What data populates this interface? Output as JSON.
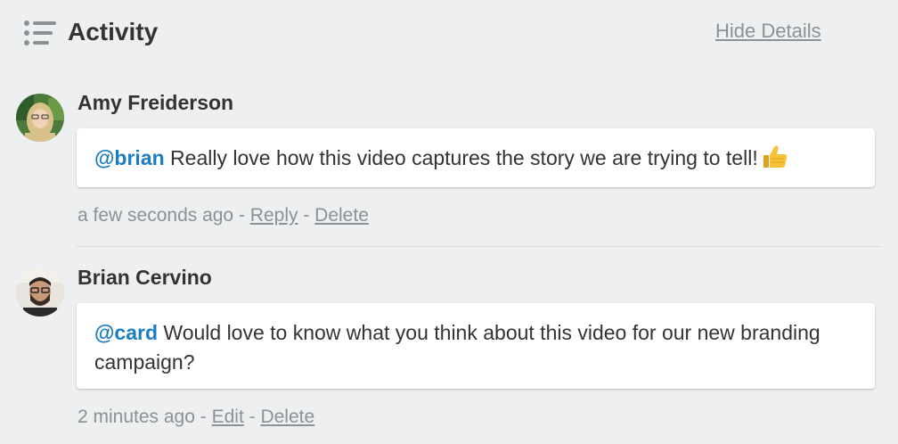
{
  "header": {
    "title": "Activity",
    "hide_details_label": "Hide Details"
  },
  "comments": [
    {
      "author": "Amy Freiderson",
      "mention": "@brian",
      "text": " Really love how this video captures the story we are trying to tell!",
      "emoji": "thumbs-up-icon",
      "timestamp": "a few seconds ago",
      "separator": " - ",
      "action1": "Reply",
      "action2": "Delete"
    },
    {
      "author": "Brian Cervino",
      "mention": "@card",
      "text": " Would love to know what you think about this video for our new branding campaign?",
      "timestamp": "2 minutes ago",
      "separator": " - ",
      "action1": "Edit",
      "action2": "Delete"
    }
  ],
  "colors": {
    "background": "#edeff0",
    "mention": "#1b7ec2",
    "meta": "#8c9194",
    "text": "#333333"
  }
}
